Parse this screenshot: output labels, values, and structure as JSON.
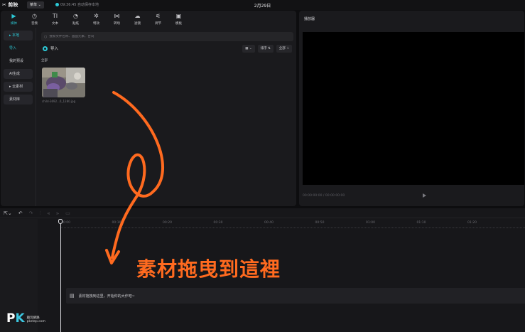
{
  "topbar": {
    "logo": "剪映",
    "menu_label": "菜单",
    "save_status": "09:36:45 自动保存本地",
    "project_title": "2月29日"
  },
  "toolbar": {
    "items": [
      {
        "label": "媒体",
        "glyph": "▶",
        "icon": "media-icon",
        "active": true
      },
      {
        "label": "音频",
        "glyph": "◷",
        "icon": "audio-icon"
      },
      {
        "label": "文本",
        "glyph": "TI",
        "icon": "text-icon"
      },
      {
        "label": "贴纸",
        "glyph": "◔",
        "icon": "sticker-icon"
      },
      {
        "label": "特效",
        "glyph": "✲",
        "icon": "effects-icon"
      },
      {
        "label": "转场",
        "glyph": "⋈",
        "icon": "transition-icon"
      },
      {
        "label": "滤镜",
        "glyph": "☁",
        "icon": "filter-icon"
      },
      {
        "label": "调节",
        "glyph": "⚟",
        "icon": "adjust-icon"
      },
      {
        "label": "模板",
        "glyph": "▣",
        "icon": "template-icon"
      }
    ]
  },
  "sidenav": {
    "local": "▸ 本地",
    "import": "导入",
    "presets": "我的预设",
    "ai": "AI生成",
    "cloud": "▸ 云素材",
    "library": "素材库"
  },
  "media": {
    "search_placeholder": "搜索文件名称、画面元素、台词",
    "import_label": "导入",
    "sort_label": "排序 ⇅",
    "filter_label": "全部 ⇂",
    "view_label": "▦ ⌄",
    "section_all": "全部",
    "thumb_name": "child-3692...0_1280.jpg"
  },
  "player": {
    "title": "播放器",
    "time": "00:00:00:00 / 00:00:00:00"
  },
  "timeline": {
    "ticks": [
      "00:00",
      "00:10",
      "00:20",
      "00:30",
      "00:40",
      "00:50",
      "01:00",
      "01:10",
      "01:20"
    ],
    "drop_hint": "素材拖拽到这里，开始你的大作吧~"
  },
  "annotation": "素材拖曳到這裡",
  "watermark": {
    "logo_p": "P",
    "logo_k": "K",
    "text": "趣玩網路\npkstep.com"
  },
  "colors": {
    "accent": "#2cc9d6",
    "annotation": "#ff6a1f",
    "panel": "#1a1a1d",
    "background": "#0d0d0f"
  }
}
